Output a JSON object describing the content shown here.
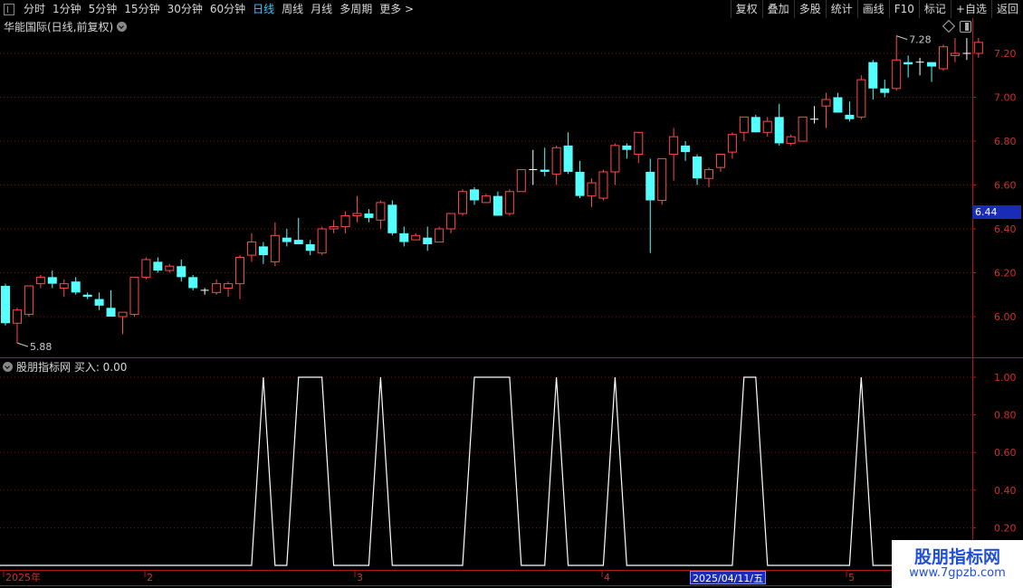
{
  "toolbar": {
    "periods": [
      "分时",
      "1分钟",
      "5分钟",
      "15分钟",
      "30分钟",
      "60分钟",
      "日线",
      "周线",
      "月线",
      "多周期",
      "更多 >"
    ],
    "active_period": "日线",
    "right_buttons": [
      "复权",
      "叠加",
      "多股",
      "统计",
      "画线",
      "F10",
      "标记",
      "+自选",
      "返回"
    ]
  },
  "main_panel": {
    "title": "华能国际(日线,前复权)",
    "high_marker": "7.28",
    "low_marker": "5.88",
    "current_price": "6.44",
    "y_ticks": [
      "7.20",
      "7.00",
      "6.80",
      "6.60",
      "6.40",
      "6.20",
      "6.00"
    ]
  },
  "indicator_panel": {
    "title": "股朋指标网 买入: 0.00",
    "y_ticks": [
      "1.00",
      "0.80",
      "0.60",
      "0.40",
      "0.20"
    ]
  },
  "x_axis": {
    "labels": [
      "2025年",
      "2",
      "3",
      "4",
      "5"
    ],
    "cursor_date": "2025/04/11/五"
  },
  "watermark": {
    "title": "股朋指标网",
    "url": "www.7gpzb.com"
  },
  "colors": {
    "up": "#ff4a4a",
    "down": "#54ffff",
    "grid": "#7a1010",
    "accent": "#1a2bb6",
    "active": "#39c9ff"
  },
  "chart_data": [
    {
      "type": "candlestick",
      "title": "华能国际(日线,前复权)",
      "ylim": [
        5.88,
        7.28
      ],
      "y_ticks": [
        6.0,
        6.2,
        6.4,
        6.6,
        6.8,
        7.0,
        7.2
      ],
      "candles": [
        {
          "o": 6.14,
          "h": 6.15,
          "l": 5.96,
          "c": 5.97
        },
        {
          "o": 5.97,
          "h": 6.04,
          "l": 5.88,
          "c": 6.03
        },
        {
          "o": 6.01,
          "h": 6.14,
          "l": 6.0,
          "c": 6.14
        },
        {
          "o": 6.15,
          "h": 6.19,
          "l": 6.13,
          "c": 6.18
        },
        {
          "o": 6.18,
          "h": 6.21,
          "l": 6.13,
          "c": 6.15
        },
        {
          "o": 6.13,
          "h": 6.17,
          "l": 6.09,
          "c": 6.15
        },
        {
          "o": 6.16,
          "h": 6.18,
          "l": 6.1,
          "c": 6.11
        },
        {
          "o": 6.1,
          "h": 6.11,
          "l": 6.08,
          "c": 6.09
        },
        {
          "o": 6.08,
          "h": 6.11,
          "l": 6.03,
          "c": 6.05
        },
        {
          "o": 6.04,
          "h": 6.12,
          "l": 6.0,
          "c": 6.0
        },
        {
          "o": 6.0,
          "h": 6.02,
          "l": 5.92,
          "c": 6.02
        },
        {
          "o": 6.01,
          "h": 6.18,
          "l": 6.0,
          "c": 6.18
        },
        {
          "o": 6.18,
          "h": 6.27,
          "l": 6.17,
          "c": 6.26
        },
        {
          "o": 6.25,
          "h": 6.27,
          "l": 6.2,
          "c": 6.21
        },
        {
          "o": 6.21,
          "h": 6.24,
          "l": 6.2,
          "c": 6.23
        },
        {
          "o": 6.23,
          "h": 6.26,
          "l": 6.16,
          "c": 6.18
        },
        {
          "o": 6.18,
          "h": 6.19,
          "l": 6.12,
          "c": 6.13
        },
        {
          "o": 6.12,
          "h": 6.13,
          "l": 6.1,
          "c": 6.12
        },
        {
          "o": 6.11,
          "h": 6.17,
          "l": 6.1,
          "c": 6.15
        },
        {
          "o": 6.13,
          "h": 6.16,
          "l": 6.09,
          "c": 6.15
        },
        {
          "o": 6.15,
          "h": 6.28,
          "l": 6.08,
          "c": 6.27
        },
        {
          "o": 6.28,
          "h": 6.38,
          "l": 6.25,
          "c": 6.34
        },
        {
          "o": 6.32,
          "h": 6.34,
          "l": 6.24,
          "c": 6.28
        },
        {
          "o": 6.25,
          "h": 6.43,
          "l": 6.23,
          "c": 6.37
        },
        {
          "o": 6.36,
          "h": 6.4,
          "l": 6.32,
          "c": 6.34
        },
        {
          "o": 6.35,
          "h": 6.45,
          "l": 6.34,
          "c": 6.33
        },
        {
          "o": 6.33,
          "h": 6.35,
          "l": 6.28,
          "c": 6.3
        },
        {
          "o": 6.29,
          "h": 6.41,
          "l": 6.28,
          "c": 6.4
        },
        {
          "o": 6.4,
          "h": 6.44,
          "l": 6.38,
          "c": 6.41
        },
        {
          "o": 6.41,
          "h": 6.48,
          "l": 6.38,
          "c": 6.46
        },
        {
          "o": 6.46,
          "h": 6.55,
          "l": 6.43,
          "c": 6.47
        },
        {
          "o": 6.47,
          "h": 6.49,
          "l": 6.43,
          "c": 6.45
        },
        {
          "o": 6.44,
          "h": 6.53,
          "l": 6.4,
          "c": 6.52
        },
        {
          "o": 6.51,
          "h": 6.53,
          "l": 6.37,
          "c": 6.38
        },
        {
          "o": 6.38,
          "h": 6.41,
          "l": 6.32,
          "c": 6.34
        },
        {
          "o": 6.35,
          "h": 6.38,
          "l": 6.35,
          "c": 6.37
        },
        {
          "o": 6.36,
          "h": 6.41,
          "l": 6.3,
          "c": 6.33
        },
        {
          "o": 6.34,
          "h": 6.41,
          "l": 6.34,
          "c": 6.4
        },
        {
          "o": 6.4,
          "h": 6.47,
          "l": 6.38,
          "c": 6.47
        },
        {
          "o": 6.47,
          "h": 6.58,
          "l": 6.46,
          "c": 6.57
        },
        {
          "o": 6.58,
          "h": 6.59,
          "l": 6.51,
          "c": 6.53
        },
        {
          "o": 6.52,
          "h": 6.56,
          "l": 6.52,
          "c": 6.55
        },
        {
          "o": 6.55,
          "h": 6.57,
          "l": 6.46,
          "c": 6.46
        },
        {
          "o": 6.47,
          "h": 6.58,
          "l": 6.46,
          "c": 6.57
        },
        {
          "o": 6.57,
          "h": 6.67,
          "l": 6.57,
          "c": 6.67
        },
        {
          "o": 6.67,
          "h": 6.76,
          "l": 6.6,
          "c": 6.67
        },
        {
          "o": 6.67,
          "h": 6.77,
          "l": 6.64,
          "c": 6.66
        },
        {
          "o": 6.65,
          "h": 6.78,
          "l": 6.6,
          "c": 6.77
        },
        {
          "o": 6.78,
          "h": 6.84,
          "l": 6.65,
          "c": 6.66
        },
        {
          "o": 6.66,
          "h": 6.71,
          "l": 6.54,
          "c": 6.55
        },
        {
          "o": 6.55,
          "h": 6.63,
          "l": 6.5,
          "c": 6.61
        },
        {
          "o": 6.54,
          "h": 6.67,
          "l": 6.53,
          "c": 6.66
        },
        {
          "o": 6.66,
          "h": 6.79,
          "l": 6.6,
          "c": 6.78
        },
        {
          "o": 6.78,
          "h": 6.79,
          "l": 6.72,
          "c": 6.76
        },
        {
          "o": 6.74,
          "h": 6.84,
          "l": 6.7,
          "c": 6.84
        },
        {
          "o": 6.66,
          "h": 6.72,
          "l": 6.29,
          "c": 6.53
        },
        {
          "o": 6.53,
          "h": 6.72,
          "l": 6.51,
          "c": 6.72
        },
        {
          "o": 6.74,
          "h": 6.86,
          "l": 6.62,
          "c": 6.82
        },
        {
          "o": 6.78,
          "h": 6.8,
          "l": 6.71,
          "c": 6.75
        },
        {
          "o": 6.73,
          "h": 6.74,
          "l": 6.6,
          "c": 6.63
        },
        {
          "o": 6.63,
          "h": 6.68,
          "l": 6.59,
          "c": 6.67
        },
        {
          "o": 6.68,
          "h": 6.74,
          "l": 6.66,
          "c": 6.74
        },
        {
          "o": 6.75,
          "h": 6.84,
          "l": 6.72,
          "c": 6.83
        },
        {
          "o": 6.84,
          "h": 6.91,
          "l": 6.8,
          "c": 6.91
        },
        {
          "o": 6.91,
          "h": 6.92,
          "l": 6.84,
          "c": 6.84
        },
        {
          "o": 6.84,
          "h": 6.91,
          "l": 6.82,
          "c": 6.89
        },
        {
          "o": 6.91,
          "h": 6.97,
          "l": 6.78,
          "c": 6.79
        },
        {
          "o": 6.79,
          "h": 6.83,
          "l": 6.78,
          "c": 6.82
        },
        {
          "o": 6.8,
          "h": 6.91,
          "l": 6.8,
          "c": 6.91
        },
        {
          "o": 6.9,
          "h": 6.96,
          "l": 6.88,
          "c": 6.9
        },
        {
          "o": 6.96,
          "h": 7.02,
          "l": 6.86,
          "c": 6.99
        },
        {
          "o": 7.0,
          "h": 7.02,
          "l": 6.93,
          "c": 6.93
        },
        {
          "o": 6.92,
          "h": 6.98,
          "l": 6.89,
          "c": 6.9
        },
        {
          "o": 6.91,
          "h": 7.1,
          "l": 6.9,
          "c": 7.08
        },
        {
          "o": 7.16,
          "h": 7.17,
          "l": 6.99,
          "c": 7.04
        },
        {
          "o": 7.04,
          "h": 7.08,
          "l": 7.0,
          "c": 7.02
        },
        {
          "o": 7.04,
          "h": 7.28,
          "l": 7.03,
          "c": 7.17
        },
        {
          "o": 7.16,
          "h": 7.19,
          "l": 7.09,
          "c": 7.15
        },
        {
          "o": 7.16,
          "h": 7.18,
          "l": 7.1,
          "c": 7.16
        },
        {
          "o": 7.16,
          "h": 7.16,
          "l": 7.07,
          "c": 7.14
        },
        {
          "o": 7.13,
          "h": 7.24,
          "l": 7.12,
          "c": 7.23
        },
        {
          "o": 7.19,
          "h": 7.27,
          "l": 7.16,
          "c": 7.2
        },
        {
          "o": 7.2,
          "h": 7.27,
          "l": 7.17,
          "c": 7.2
        },
        {
          "o": 7.2,
          "h": 7.27,
          "l": 7.18,
          "c": 7.25
        }
      ]
    },
    {
      "type": "line",
      "title": "股朋指标网 买入: 0.00",
      "ylim": [
        0,
        1.0
      ],
      "y_ticks": [
        0.2,
        0.4,
        0.6,
        0.8,
        1.0
      ],
      "series": [
        {
          "name": "买入",
          "values": [
            0,
            0,
            0,
            0,
            0,
            0,
            0,
            0,
            0,
            0,
            0,
            0,
            0,
            0,
            0,
            0,
            0,
            0,
            0,
            0,
            0,
            0,
            1,
            0,
            0,
            1,
            1,
            1,
            0,
            0,
            0,
            0,
            1,
            0,
            0,
            0,
            0,
            0,
            0,
            0,
            1,
            1,
            1,
            1,
            0,
            0,
            0,
            1,
            0,
            0,
            0,
            0,
            1,
            0,
            0,
            0,
            0,
            0,
            0,
            0,
            0,
            0,
            0,
            1,
            1,
            0,
            0,
            0,
            0,
            0,
            0,
            0,
            0,
            1,
            0,
            0,
            0,
            0,
            0,
            0,
            0,
            0
          ]
        }
      ]
    }
  ]
}
